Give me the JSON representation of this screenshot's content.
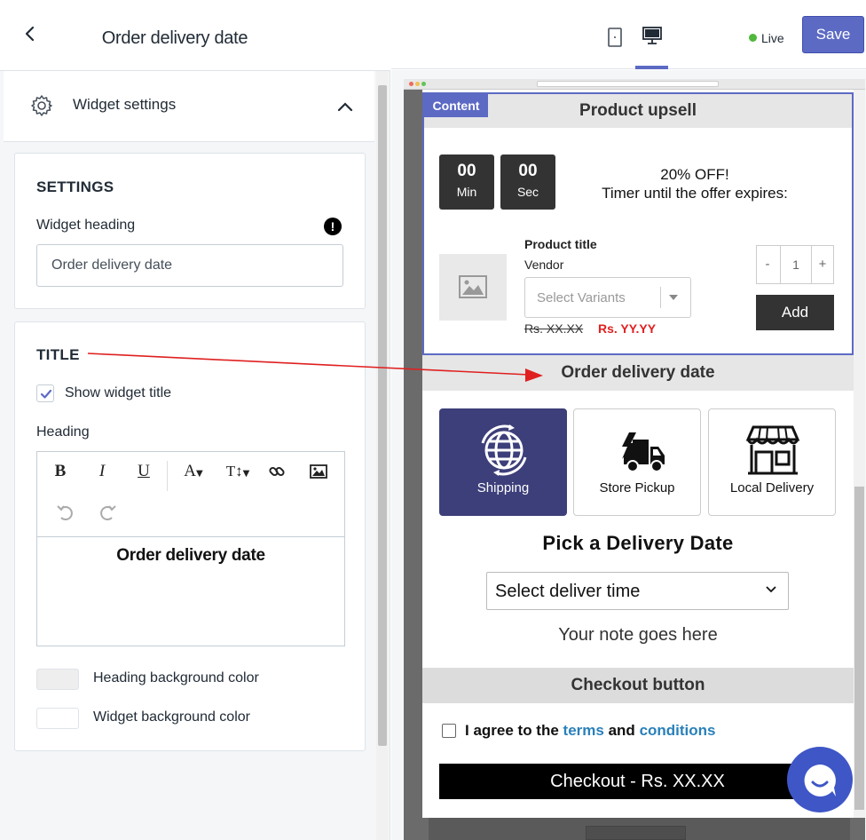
{
  "left_panel": {
    "title": "Order delivery date",
    "section": {
      "label": "Widget settings",
      "icon": "gear-icon"
    },
    "settings_card": {
      "heading": "SETTINGS",
      "widget_heading_label": "Widget heading",
      "widget_heading_value": "Order delivery date"
    },
    "title_card": {
      "heading": "TITLE",
      "show_title_label": "Show widget title",
      "show_title_checked": true,
      "heading_label": "Heading",
      "toolbar": {
        "bold": "B",
        "italic": "I",
        "underline": "U",
        "font_color": "A",
        "font_size": "T↕"
      },
      "editor_text": "Order delivery date",
      "heading_bg_label": "Heading background color",
      "heading_bg_color": "#eeeeee",
      "widget_bg_label": "Widget background color",
      "widget_bg_color": "#ffffff"
    }
  },
  "topbar": {
    "status": "Live",
    "save_label": "Save",
    "accent": "#5c6ac4"
  },
  "preview": {
    "content_tag": "Content",
    "upsell": {
      "heading": "Product upsell",
      "timer_min_value": "00",
      "timer_min_label": "Min",
      "timer_sec_value": "00",
      "timer_sec_label": "Sec",
      "offer_line1": "20% OFF!",
      "offer_line2": "Timer until the offer expires:",
      "product_title": "Product title",
      "vendor": "Vendor",
      "variants_placeholder": "Select Variants",
      "price_old": "Rs. XX.XX",
      "price_new": "Rs. YY.YY",
      "qty_minus": "-",
      "qty_value": "1",
      "qty_plus": "+",
      "add_label": "Add"
    },
    "delivery": {
      "heading": "Order delivery date",
      "options": [
        {
          "label": "Shipping",
          "icon": "globe-icon",
          "active": true
        },
        {
          "label": "Store Pickup",
          "icon": "truck-icon",
          "active": false
        },
        {
          "label": "Local Delivery",
          "icon": "store-icon",
          "active": false
        }
      ],
      "pick_title": "Pick a Delivery Date",
      "select_time": "Select deliver time",
      "note": "Your note goes here"
    },
    "checkout": {
      "heading": "Checkout button",
      "agree_prefix": "I agree to the",
      "agree_terms": "terms",
      "agree_and": "and",
      "agree_conditions": "conditions",
      "button_label": "Checkout - Rs. XX.XX"
    }
  }
}
